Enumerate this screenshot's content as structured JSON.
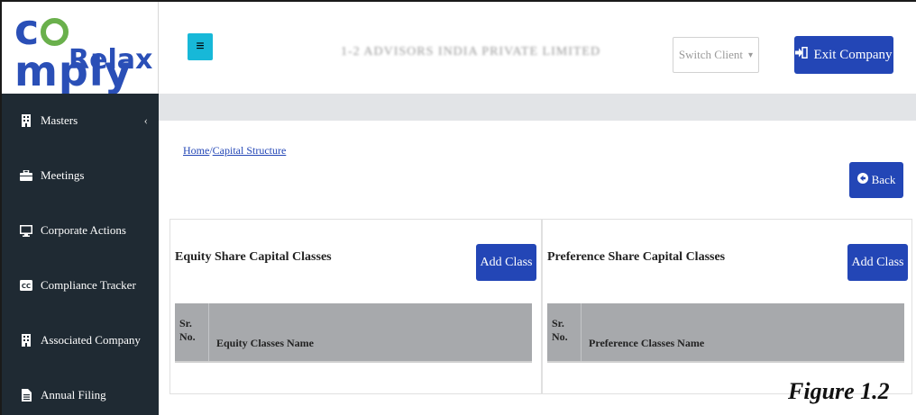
{
  "logo": {
    "top": "comply",
    "bottom": "Relax"
  },
  "sidebar": {
    "items": [
      {
        "label": "Masters",
        "icon": "building-icon",
        "chevron": "‹"
      },
      {
        "label": "Meetings",
        "icon": "briefcase-icon"
      },
      {
        "label": "Corporate Actions",
        "icon": "monitor-icon"
      },
      {
        "label": "Compliance Tracker",
        "icon": "cc-icon"
      },
      {
        "label": "Associated Company",
        "icon": "building-icon"
      },
      {
        "label": "Annual Filing",
        "icon": "file-icon"
      }
    ]
  },
  "header": {
    "menu_glyph": "≡",
    "company_name": "1-2 ADVISORS INDIA PRIVATE LIMITED",
    "switch_client": {
      "label": "Switch Client",
      "caret": "▾"
    },
    "exit_button": "Exit Company"
  },
  "breadcrumb": {
    "home": "Home",
    "separator": "/",
    "current": "Capital Structure"
  },
  "back_button": "Back",
  "equity_panel": {
    "title": "Equity Share Capital Classes",
    "add_button": "Add Class",
    "columns": [
      "Sr. No.",
      "Equity Classes Name"
    ]
  },
  "preference_panel": {
    "title": "Preference Share Capital Classes",
    "add_button": "Add Class",
    "columns": [
      "Sr. No.",
      "Preference Classes Name"
    ]
  },
  "figure_label": "Figure 1.2",
  "colors": {
    "brand_blue": "#2346b6",
    "sidebar_bg": "#1f2a33",
    "menu_button": "#17b8d8",
    "logo_green": "#6ab04c"
  }
}
